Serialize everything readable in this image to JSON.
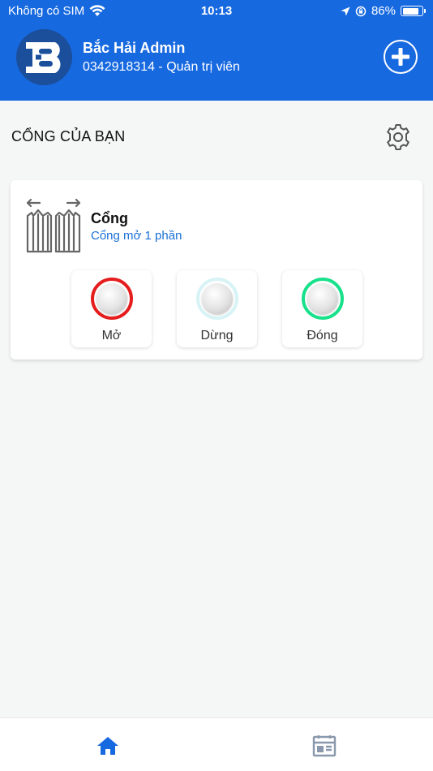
{
  "status_bar": {
    "carrier": "Không có SIM",
    "time": "10:13",
    "battery": "86%",
    "battery_level": 0.86
  },
  "header": {
    "user_name": "Bắc Hải Admin",
    "user_subtitle": "0342918314 - Quản trị viên",
    "avatar_letter": "B"
  },
  "section": {
    "title": "CỔNG CỦA BẠN"
  },
  "gate_card": {
    "name": "Cổng",
    "status": "Cổng mở 1 phần",
    "controls": [
      {
        "label": "Mở",
        "ring_color": "#e51d1d"
      },
      {
        "label": "Dừng",
        "ring_color": "#d7f3f6"
      },
      {
        "label": "Đóng",
        "ring_color": "#19e08a"
      }
    ]
  },
  "tabbar": {
    "items": [
      {
        "icon": "home-icon",
        "active": true
      },
      {
        "icon": "calendar-icon",
        "active": false
      }
    ]
  },
  "colors": {
    "primary": "#1769e0",
    "status_text": "#1a6fd6",
    "tab_active": "#1769e0",
    "tab_inactive": "#8a98ad"
  }
}
